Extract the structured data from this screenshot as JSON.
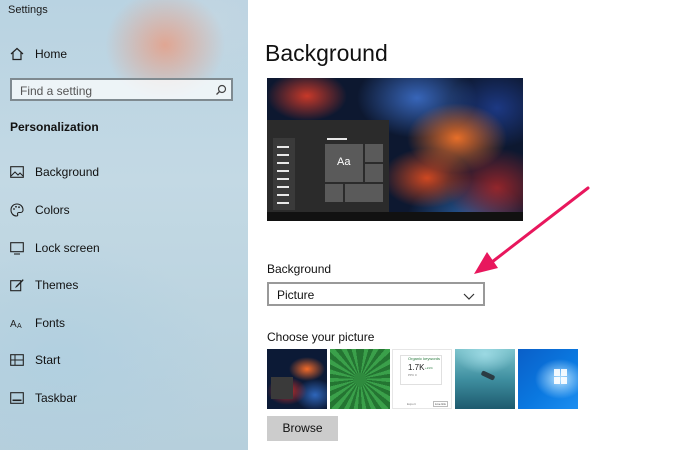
{
  "window": {
    "title": "Settings"
  },
  "sidebar": {
    "home_label": "Home",
    "search_placeholder": "Find a setting",
    "section_title": "Personalization",
    "items": [
      {
        "label": "Background",
        "icon": "picture-icon",
        "selected": true
      },
      {
        "label": "Colors",
        "icon": "palette-icon"
      },
      {
        "label": "Lock screen",
        "icon": "lock-screen-icon"
      },
      {
        "label": "Themes",
        "icon": "themes-brush-icon"
      },
      {
        "label": "Fonts",
        "icon": "fonts-icon"
      },
      {
        "label": "Start",
        "icon": "start-icon"
      },
      {
        "label": "Taskbar",
        "icon": "taskbar-icon"
      }
    ]
  },
  "main": {
    "title": "Background",
    "preview": {
      "sample_text": "Aa"
    },
    "background_label": "Background",
    "background_select": {
      "value": "Picture",
      "icon": "chevron-down-icon"
    },
    "choose_label": "Choose your picture",
    "thumbnails": [
      {
        "name": "abstract-smoke"
      },
      {
        "name": "green-fern"
      },
      {
        "name": "analytics-screenshot",
        "keyword_label": "Organic keywords",
        "value": "1.7K",
        "delta": "+21%",
        "sub": "PPC 0",
        "export": "Export",
        "link": "Live link"
      },
      {
        "name": "underwater-diver"
      },
      {
        "name": "windows-blue"
      }
    ],
    "browse_label": "Browse"
  },
  "annotation": {
    "color": "#e8175d",
    "icon": "arrow-pointer-icon"
  }
}
